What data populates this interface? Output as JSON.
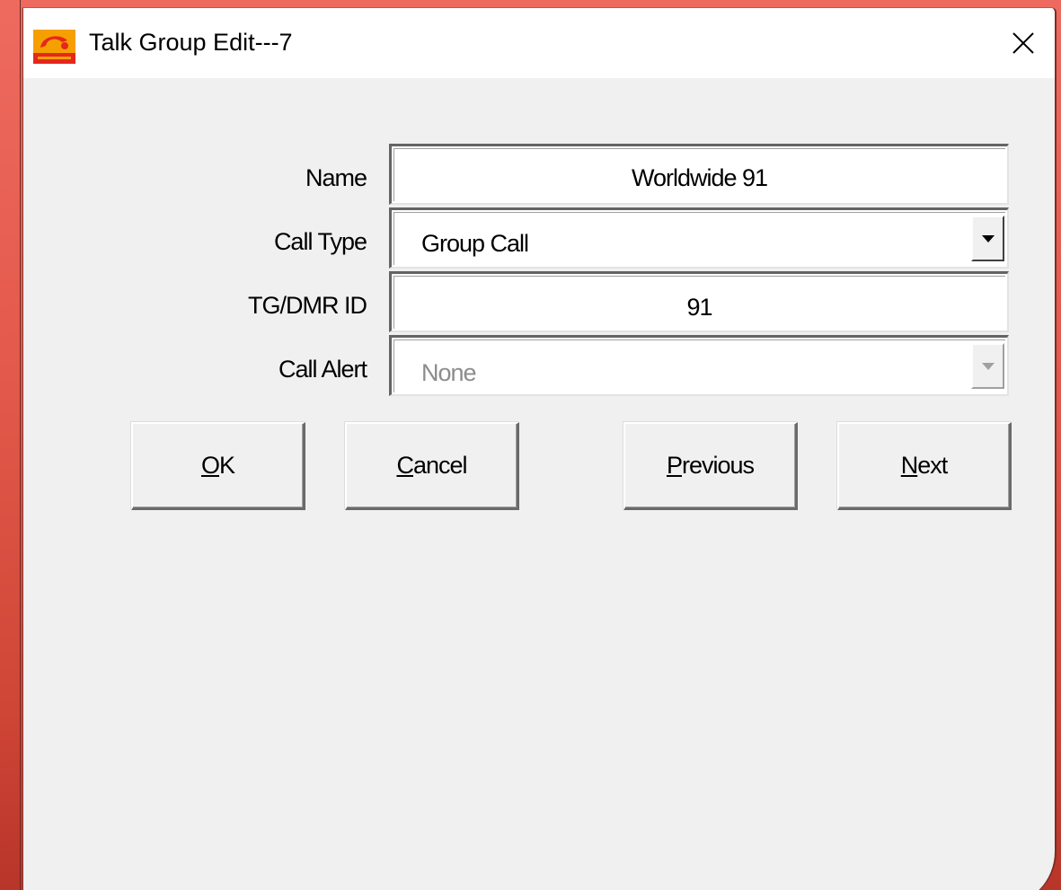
{
  "window": {
    "title": "Talk Group Edit---7",
    "app_icon": "app-logo-icon",
    "close_icon": "close-icon"
  },
  "form": {
    "name": {
      "label": "Name",
      "value": "Worldwide 91"
    },
    "call_type": {
      "label": "Call Type",
      "value": "Group Call"
    },
    "tg_dmr_id": {
      "label": "TG/DMR ID",
      "value": "91"
    },
    "call_alert": {
      "label": "Call Alert",
      "value": "None",
      "disabled": true
    }
  },
  "buttons": {
    "ok": {
      "accel": "O",
      "rest": "K"
    },
    "cancel": {
      "accel": "C",
      "rest": "ancel"
    },
    "previous": {
      "accel": "P",
      "rest": "revious"
    },
    "next": {
      "accel": "N",
      "rest": "ext"
    }
  },
  "colors": {
    "desktop": "#e45a4c",
    "dialog_bg": "#f0f0f0",
    "titlebar": "#ffffff",
    "icon_orange": "#f5a000",
    "icon_red": "#e5271d"
  }
}
